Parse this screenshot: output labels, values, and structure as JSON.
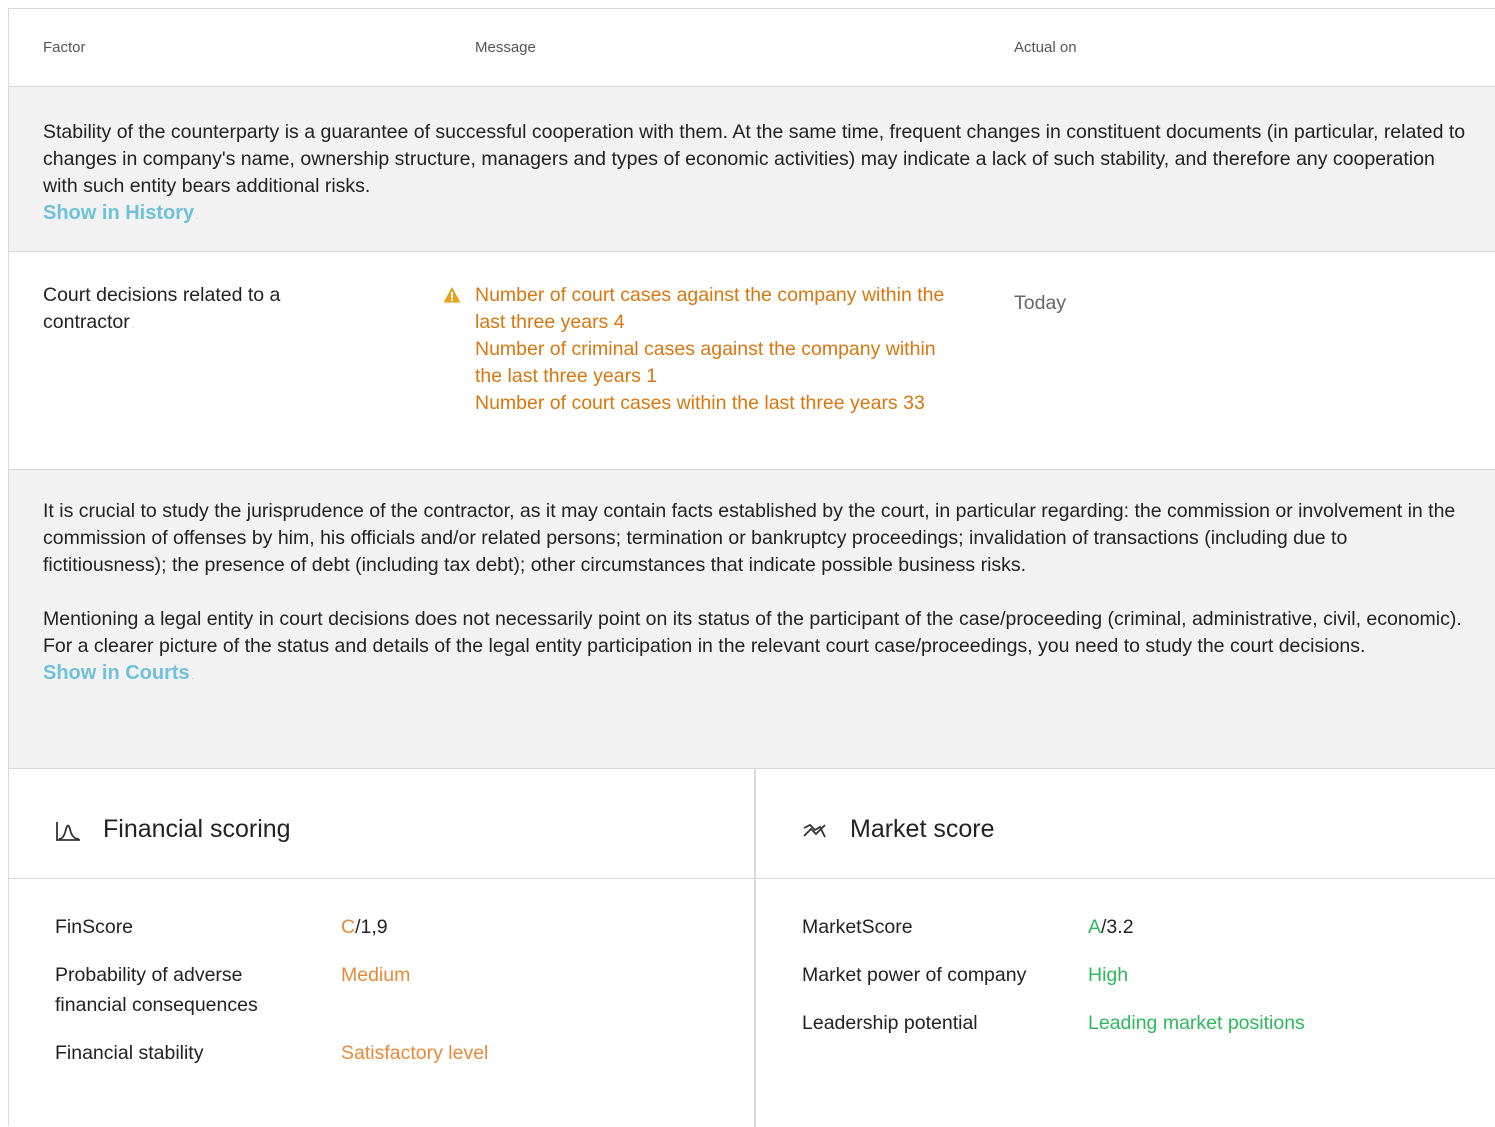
{
  "header": {
    "factor": "Factor",
    "message": "Message",
    "actual_on": "Actual on"
  },
  "history_note": {
    "text": "Stability of the counterparty is a guarantee of successful cooperation with them. At the same time, frequent changes in constituent documents (in particular, related to changes in company's name, ownership structure, managers and types of economic activities) may indicate a lack of such stability, and therefore any cooperation with such entity bears additional risks.",
    "link_label": "Show in History"
  },
  "court_row": {
    "factor": "Court decisions related to a contractor",
    "messages": [
      "Number of court cases against the company within the last three years 4",
      "Number of criminal cases against the company within the last three years 1",
      "Number of court cases within the last three years 33"
    ],
    "actual_on": "Today",
    "warning_icon": "warning-triangle-icon",
    "message_color": "#d8770f"
  },
  "court_note": {
    "paragraph1": "It is crucial to study the jurisprudence of the contractor, as it may contain facts established by the court, in particular regarding: the commission or involvement in the commission of offenses by him, his officials and/or related persons; termination or bankruptcy proceedings; invalidation of transactions (including due to fictitiousness); the presence of debt (including tax debt); other circumstances that indicate possible business risks.",
    "paragraph2": "Mentioning a legal entity in court decisions does not necessarily point on its status of the participant of the case/proceeding (criminal, administrative, civil, economic). For a clearer picture of the status and details of the legal entity participation in the relevant court case/proceedings, you need to study the court decisions.",
    "link_label": "Show in Courts"
  },
  "financial": {
    "title": "Financial scoring",
    "icon": "distribution-curve-icon",
    "accent": "#e8893a",
    "finscore_label": "FinScore",
    "finscore_grade": "C",
    "finscore_value": "/1,9",
    "probability_label": "Probability of adverse financial consequences",
    "probability_value": "Medium",
    "stability_label": "Financial stability",
    "stability_value": "Satisfactory level"
  },
  "market": {
    "title": "Market score",
    "icon": "trend-arrow-icon",
    "accent": "#2db85c",
    "marketscore_label": "MarketScore",
    "marketscore_grade": "A",
    "marketscore_value": "/3.2",
    "power_label": "Market power of company",
    "power_value": "High",
    "leadership_label": "Leadership potential",
    "leadership_value": "Leading market positions"
  },
  "link_color": "#6ec1d9"
}
